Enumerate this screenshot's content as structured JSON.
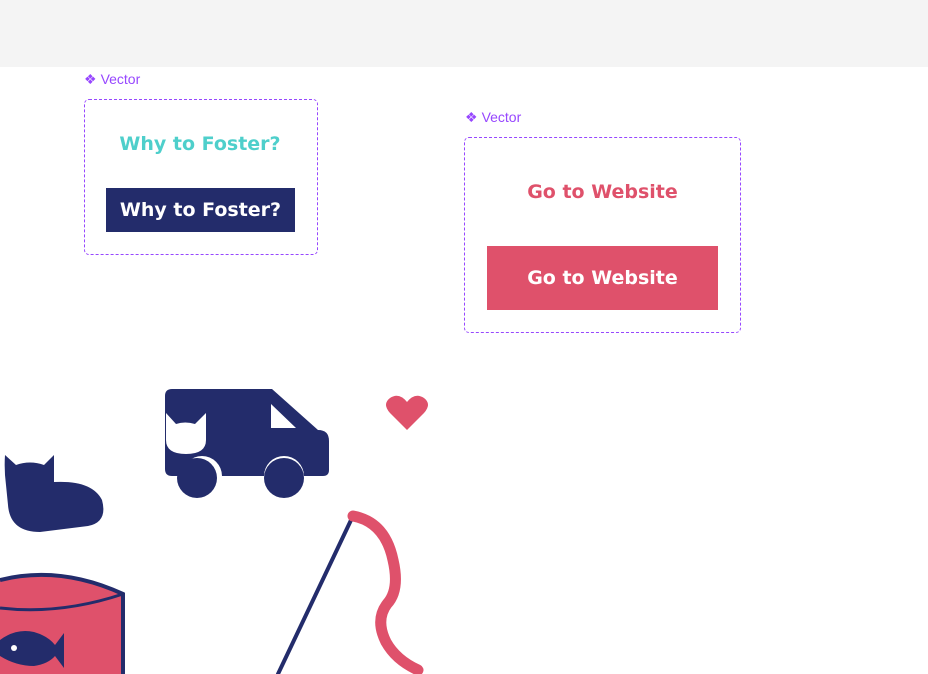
{
  "canvas": {
    "topbar_color": "#f4f4f4",
    "background": "#ffffff"
  },
  "components": [
    {
      "label": "Vector",
      "label_icon": "component-diamond-icon",
      "variants": [
        {
          "style": "text",
          "text": "Why to Foster?",
          "color": "#4ecfcb"
        },
        {
          "style": "filled",
          "text": "Why to Foster?",
          "color": "#ffffff",
          "bg": "#232c6b"
        }
      ]
    },
    {
      "label": "Vector",
      "label_icon": "component-diamond-icon",
      "variants": [
        {
          "style": "text",
          "text": "Go to Website",
          "color": "#df516b"
        },
        {
          "style": "filled",
          "text": "Go to Website",
          "color": "#ffffff",
          "bg": "#df516b"
        }
      ]
    }
  ],
  "illustrations": {
    "navy": "#232c6b",
    "pink": "#df516b",
    "items": [
      "cat-icon",
      "delivery-van-icon",
      "heart-icon",
      "cat-food-can-icon",
      "fishing-rod-toy-icon"
    ]
  }
}
